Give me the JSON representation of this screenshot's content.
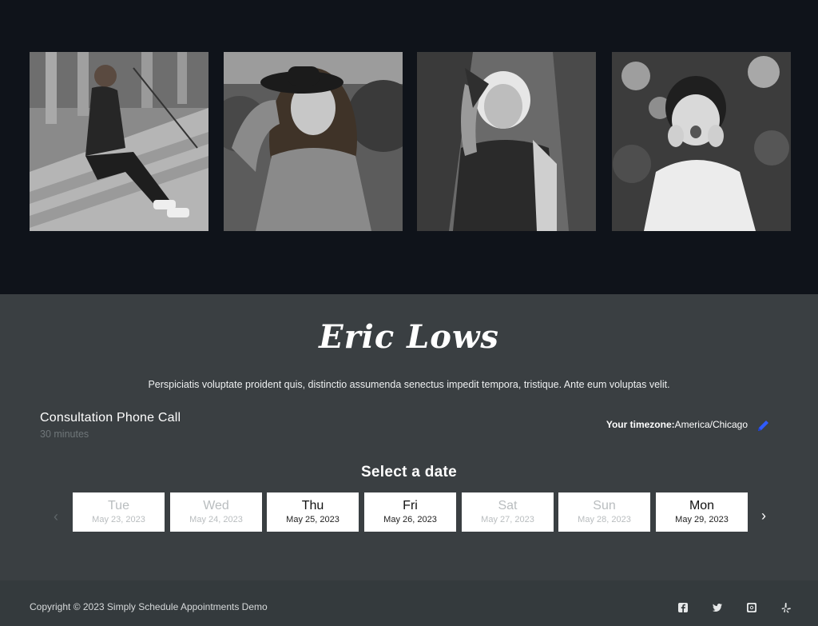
{
  "booking": {
    "brand": "Eric Lows",
    "tagline": "Perspiciatis voluptate proident quis, distinctio assumenda senectus impedit tempora, tristique. Ante eum voluptas velit.",
    "service": {
      "title": "Consultation Phone Call",
      "duration": "30 minutes"
    },
    "timezone": {
      "label": "Your timezone:",
      "value": "America/Chicago"
    },
    "select_date_heading": "Select a date",
    "days": [
      {
        "name": "Tue",
        "date": "May 23, 2023",
        "available": false
      },
      {
        "name": "Wed",
        "date": "May 24, 2023",
        "available": false
      },
      {
        "name": "Thu",
        "date": "May 25, 2023",
        "available": true
      },
      {
        "name": "Fri",
        "date": "May 26, 2023",
        "available": true
      },
      {
        "name": "Sat",
        "date": "May 27, 2023",
        "available": false
      },
      {
        "name": "Sun",
        "date": "May 28, 2023",
        "available": false
      },
      {
        "name": "Mon",
        "date": "May 29, 2023",
        "available": true
      }
    ],
    "prev_icon": "chevron-left-icon",
    "next_icon": "chevron-right-icon",
    "edit_icon": "pencil-icon",
    "accent_color": "#2f5bff"
  },
  "footer": {
    "copyright": "Copyright © 2023 Simply Schedule Appointments Demo",
    "social": [
      "facebook-icon",
      "twitter-icon",
      "instagram-icon",
      "yelp-icon"
    ]
  },
  "colors": {
    "gallery_bg": "#0f131a",
    "booking_bg": "#3a3f42",
    "footer_bg": "#343a3d"
  }
}
